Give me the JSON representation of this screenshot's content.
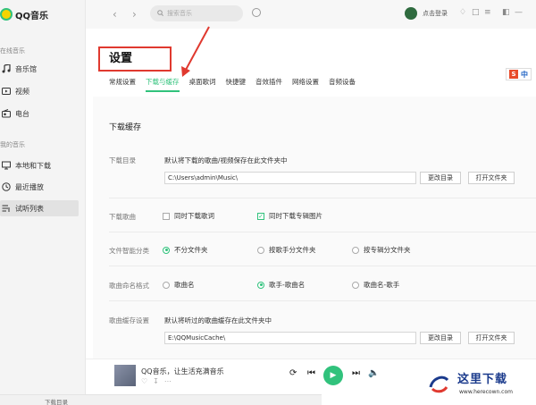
{
  "app": {
    "name": "QQ音乐"
  },
  "sidebar": {
    "online_section": "在线音乐",
    "my_section": "我的音乐",
    "online_items": [
      {
        "label": "音乐馆",
        "icon": "music-note-icon"
      },
      {
        "label": "视频",
        "icon": "video-icon"
      },
      {
        "label": "电台",
        "icon": "radio-icon"
      }
    ],
    "my_items": [
      {
        "label": "本地和下载",
        "icon": "monitor-icon"
      },
      {
        "label": "最近播放",
        "icon": "clock-icon"
      },
      {
        "label": "试听列表",
        "icon": "playlist-icon",
        "active": true
      }
    ]
  },
  "topbar": {
    "search_placeholder": "搜索音乐",
    "login_label": "点击登录"
  },
  "settings": {
    "title": "设置",
    "tabs": [
      "常规设置",
      "下载与缓存",
      "桌面歌词",
      "快捷键",
      "音效插件",
      "网络设置",
      "音频设备"
    ],
    "active_tab": 1,
    "section_title": "下载缓存",
    "rows": {
      "download_dir": {
        "label": "下载目录",
        "desc": "默认将下载的歌曲/视频保存在此文件夹中",
        "path": "C:\\Users\\admin\\Music\\",
        "change_btn": "更改目录",
        "open_btn": "打开文件夹"
      },
      "download_song": {
        "label": "下载歌曲",
        "opt1": "同时下载歌词",
        "opt1_checked": false,
        "opt2": "同时下载专辑图片",
        "opt2_checked": true
      },
      "smart_classify": {
        "label": "文件智能分类",
        "options": [
          "不分文件夹",
          "按歌手分文件夹",
          "按专辑分文件夹"
        ],
        "selected": 0
      },
      "naming": {
        "label": "歌曲命名格式",
        "options": [
          "歌曲名",
          "歌手-歌曲名",
          "歌曲名-歌手"
        ],
        "selected": 1
      },
      "cache": {
        "label": "歌曲缓存设置",
        "desc": "默认将听过的歌曲缓存在此文件夹中",
        "path": "E:\\QQMusicCache\\",
        "change_btn": "更改目录",
        "open_btn": "打开文件夹"
      }
    }
  },
  "player": {
    "song_title": "QQ音乐，让生活充满音乐"
  },
  "bottom_strip": {
    "text": "下载目录"
  },
  "ime": {
    "label": "中"
  },
  "watermark": {
    "text": "这里下载",
    "url": "www.herecown.com"
  },
  "colors": {
    "accent": "#31c27c",
    "annotation_red": "#e0392f"
  }
}
